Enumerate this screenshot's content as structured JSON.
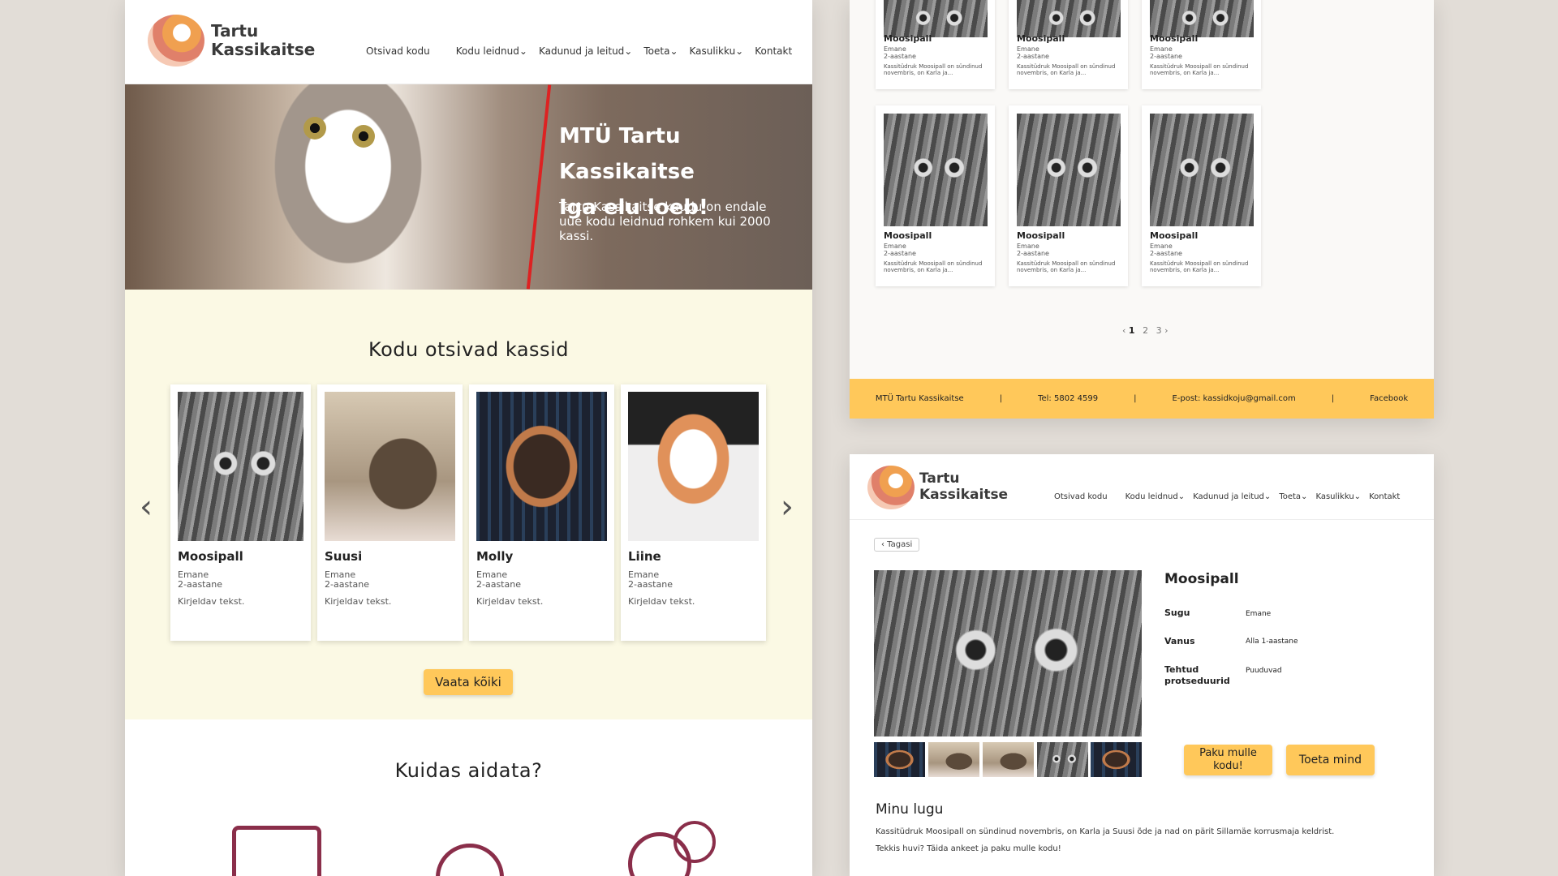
{
  "site": {
    "logo_line1": "Tartu",
    "logo_line2": "Kassikaitse",
    "nav": [
      "Otsivad kodu",
      "Kodu leidnud",
      "Kadunud ja leitud",
      "Toeta",
      "Kasulikku",
      "Kontakt"
    ],
    "dropdown_mark": "⌄"
  },
  "hero": {
    "title_line1": "MTÜ Tartu Kassikaitse",
    "title_line2": "Iga elu loeb!",
    "text": "Tartu Kassikaitse kaudu on endale uue kodu leidnud rohkem kui 2000 kassi."
  },
  "home": {
    "section_title": "Kodu otsivad kassid",
    "prev": "‹",
    "next": "›",
    "cats": [
      {
        "name": "Moosipall",
        "sex": "Emane",
        "age": "2-aastane",
        "desc": "Kirjeldav tekst."
      },
      {
        "name": "Suusi",
        "sex": "Emane",
        "age": "2-aastane",
        "desc": "Kirjeldav tekst."
      },
      {
        "name": "Molly",
        "sex": "Emane",
        "age": "2-aastane",
        "desc": "Kirjeldav tekst."
      },
      {
        "name": "Liine",
        "sex": "Emane",
        "age": "2-aastane",
        "desc": "Kirjeldav tekst."
      }
    ],
    "see_all": "Vaata kõiki",
    "help_title": "Kuidas aidata?"
  },
  "grid": {
    "card": {
      "name": "Moosipall",
      "sex": "Emane",
      "age": "2-aastane",
      "desc": "Kassitüdruk Moosipall on sündinud novembris, on Karla ja..."
    },
    "pager": {
      "prev": "‹",
      "pages": [
        "1",
        "2",
        "3"
      ],
      "next": "›"
    }
  },
  "footer": {
    "org": "MTÜ Tartu Kassikaitse",
    "sep": "|",
    "tel": "Tel: 5802 4599",
    "email": "E-post: kassidkoju@gmail.com",
    "facebook": "Facebook"
  },
  "detail": {
    "back": "‹  Tagasi",
    "name": "Moosipall",
    "fields": [
      {
        "label": "Sugu",
        "value": "Emane"
      },
      {
        "label": "Vanus",
        "value": "Alla 1-aastane"
      },
      {
        "label": "Tehtud protseduurid",
        "value": "Puuduvad"
      }
    ],
    "offer_btn": "Paku mulle kodu!",
    "support_btn": "Toeta mind",
    "story_title": "Minu lugu",
    "story_text1": "Kassitüdruk Moosipall on sündinud novembris, on Karla ja Suusi õde ja nad on pärit Sillamäe korrusmaja keldrist.",
    "story_text2": "Tekkis huvi? Täida ankeet ja paku mulle kodu!"
  },
  "colors": {
    "accent": "#ffc85a",
    "cream": "#fbf9e4",
    "icon": "#8a2e4a"
  }
}
